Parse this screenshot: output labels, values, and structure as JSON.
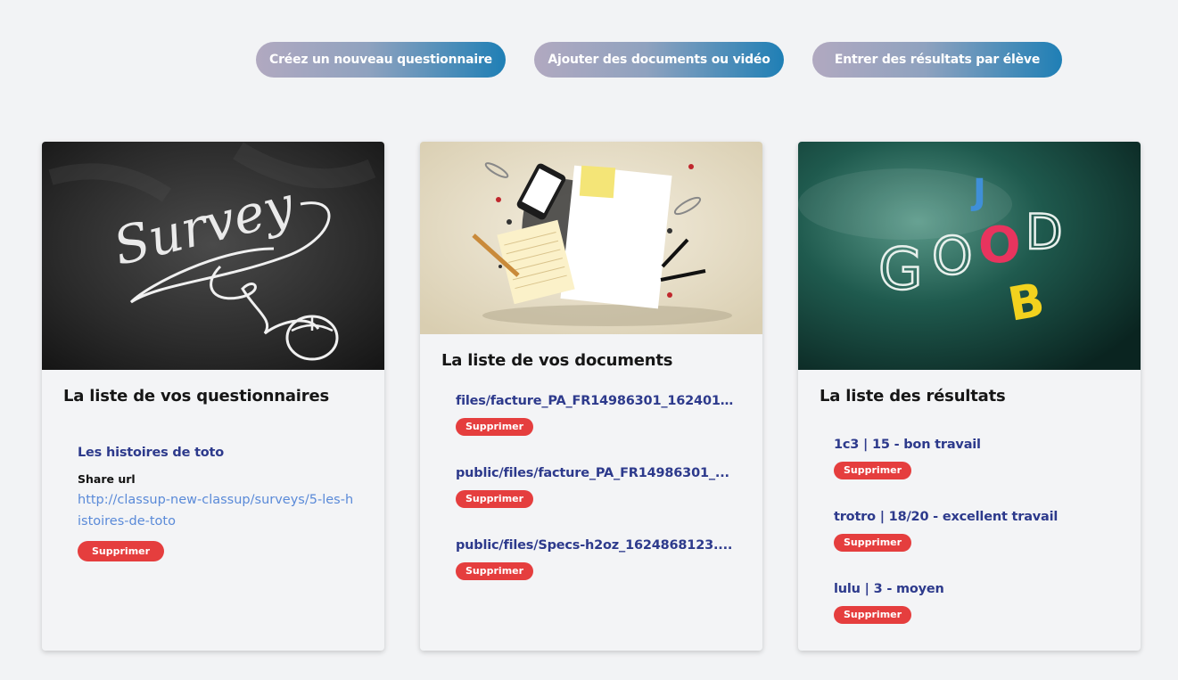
{
  "actions": {
    "new_survey": "Créez un nouveau questionnaire",
    "add_documents": "Ajouter des documents ou vidéo",
    "enter_results": "Entrer des résultats par élève"
  },
  "surveys_card": {
    "title": "La liste de vos questionnaires",
    "media_text": "Survey",
    "items": [
      {
        "name": "Les histoires de toto",
        "share_label": "Share url",
        "share_url": "http://classup-new-classup/surveys/5-les-histoires-de-toto",
        "delete_label": "Supprimer"
      }
    ]
  },
  "documents_card": {
    "title": "La liste de vos documents",
    "items": [
      {
        "name": "files/facture_PA_FR14986301_1624016...",
        "delete_label": "Supprimer"
      },
      {
        "name": "public/files/facture_PA_FR14986301_...",
        "delete_label": "Supprimer"
      },
      {
        "name": "public/files/Specs-h2oz_1624868123....",
        "delete_label": "Supprimer"
      }
    ]
  },
  "results_card": {
    "title": "La liste des résultats",
    "media_text": {
      "j": "J",
      "g": "G",
      "o1": "O",
      "o2": "O",
      "d": "D",
      "b": "B"
    },
    "items": [
      {
        "name": "1c3 | 15 - bon travail",
        "delete_label": "Supprimer"
      },
      {
        "name": "trotro | 18/20 - excellent travail",
        "delete_label": "Supprimer"
      },
      {
        "name": "lulu | 3 - moyen",
        "delete_label": "Supprimer"
      }
    ]
  },
  "colors": {
    "accent_start": "#b1a9c0",
    "accent_end": "#1f7fb5",
    "link": "#2d3a8c",
    "delete": "#e53e3e",
    "share_url": "#5a8ad8"
  }
}
